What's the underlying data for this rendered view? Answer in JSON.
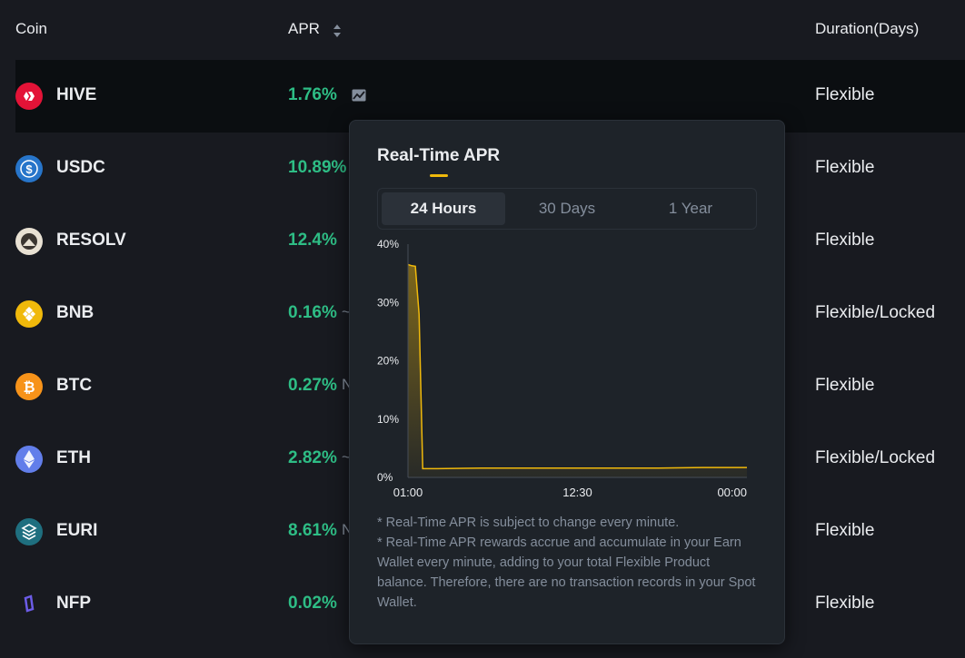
{
  "table": {
    "headers": {
      "coin": "Coin",
      "apr": "APR",
      "duration": "Duration(Days)"
    },
    "rows": [
      {
        "coin": "HIVE",
        "apr": "1.76%",
        "extra": "",
        "duration": "Flexible",
        "icon": "hive-icon",
        "color": "#e31337"
      },
      {
        "coin": "USDC",
        "apr": "10.89%",
        "extra": "",
        "duration": "Flexible",
        "icon": "usdc-icon",
        "color": "#2775ca"
      },
      {
        "coin": "RESOLV",
        "apr": "12.4%",
        "extra": "",
        "duration": "Flexible",
        "icon": "resolv-icon",
        "color": "#e8e1d3"
      },
      {
        "coin": "BNB",
        "apr": "0.16%",
        "extra": "~",
        "duration": "Flexible/Locked",
        "icon": "bnb-icon",
        "color": "#f0b90b"
      },
      {
        "coin": "BTC",
        "apr": "0.27%",
        "extra": "N",
        "duration": "Flexible",
        "icon": "btc-icon",
        "color": "#f7931a"
      },
      {
        "coin": "ETH",
        "apr": "2.82%",
        "extra": "~",
        "duration": "Flexible/Locked",
        "icon": "eth-icon",
        "color": "#627eea"
      },
      {
        "coin": "EURI",
        "apr": "8.61%",
        "extra": "N",
        "duration": "Flexible",
        "icon": "euri-icon",
        "color": "#1f6f7f"
      },
      {
        "coin": "NFP",
        "apr": "0.02%",
        "extra": "",
        "duration": "Flexible",
        "icon": "nfp-icon",
        "color": "#6c5ce7"
      }
    ]
  },
  "popup": {
    "title": "Real-Time APR",
    "tabs": [
      "24 Hours",
      "30 Days",
      "1 Year"
    ],
    "active_tab": 0,
    "notes": [
      "* Real-Time APR is subject to change every minute.",
      "* Real-Time APR rewards accrue and accumulate in your Earn Wallet every minute, adding to your total Flexible Product balance. Therefore, there are no transaction records in your Spot Wallet."
    ]
  },
  "colors": {
    "accent": "#f0b90b",
    "green": "#2ebd85"
  },
  "chart_data": {
    "type": "area",
    "x": [
      "01:00",
      "01:15",
      "01:30",
      "01:45",
      "02:00",
      "03:00",
      "06:00",
      "09:00",
      "12:30",
      "15:00",
      "18:00",
      "21:00",
      "00:00"
    ],
    "series": [
      {
        "values": [
          36.5,
          36.3,
          36.2,
          28,
          1.5,
          1.5,
          1.6,
          1.6,
          1.6,
          1.6,
          1.6,
          1.7,
          1.7
        ]
      }
    ],
    "xticks": [
      "01:00",
      "12:30",
      "00:00"
    ],
    "yticks": [
      "0%",
      "10%",
      "20%",
      "30%",
      "40%"
    ],
    "ylim": [
      0,
      40
    ],
    "grid": false
  }
}
